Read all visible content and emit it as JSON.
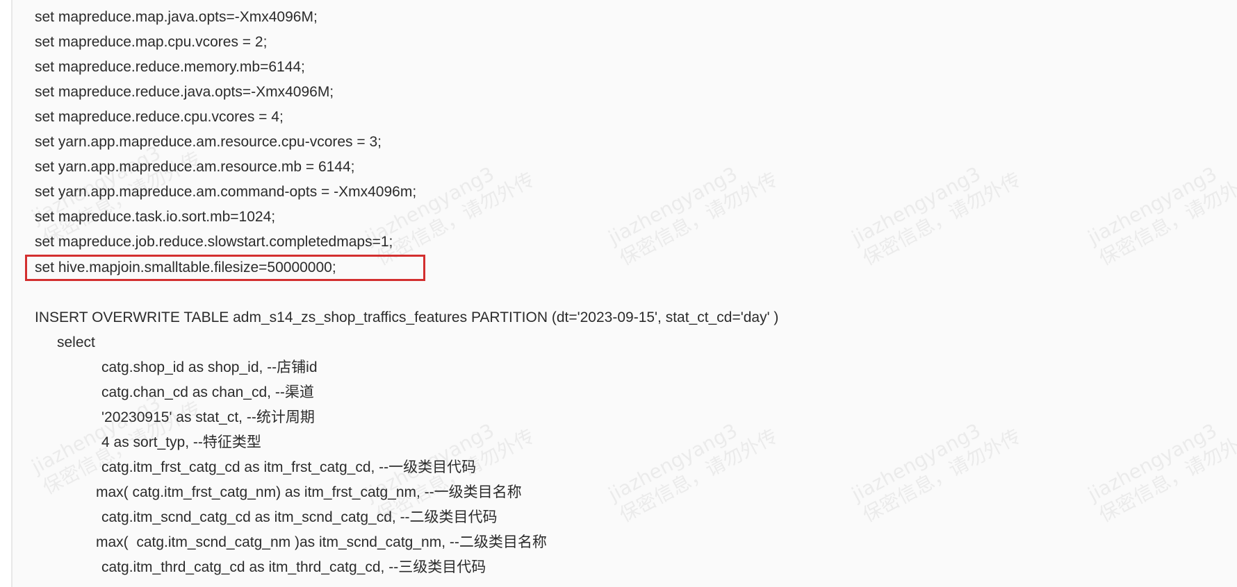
{
  "colors": {
    "background": "#fafafa",
    "text": "#2b2b2b",
    "highlight_border": "#d32f2f",
    "watermark": "#969696"
  },
  "watermark": {
    "username": "jiazhengyang3",
    "notice": "保密信息，请勿外传"
  },
  "code_lines": [
    "set mapreduce.map.java.opts=-Xmx4096M;",
    "set mapreduce.map.cpu.vcores = 2;",
    "set mapreduce.reduce.memory.mb=6144;",
    "set mapreduce.reduce.java.opts=-Xmx4096M;",
    "set mapreduce.reduce.cpu.vcores = 4;",
    "set yarn.app.mapreduce.am.resource.cpu-vcores = 3;",
    "set yarn.app.mapreduce.am.resource.mb = 6144;",
    "set yarn.app.mapreduce.am.command-opts = -Xmx4096m;",
    "set mapreduce.task.io.sort.mb=1024;",
    "set mapreduce.job.reduce.slowstart.completedmaps=1;",
    "set hive.mapjoin.smalltable.filesize=50000000;",
    "INSERT OVERWRITE TABLE adm_s14_zs_shop_traffics_features PARTITION (dt='2023-09-15', stat_ct_cd='day' )",
    "select",
    "catg.shop_id as shop_id, --店铺id",
    "catg.chan_cd as chan_cd, --渠道",
    "'20230915' as stat_ct, --统计周期",
    "4 as sort_typ, --特征类型",
    "catg.itm_frst_catg_cd as itm_frst_catg_cd, --一级类目代码",
    "max( catg.itm_frst_catg_nm) as itm_frst_catg_nm, --一级类目名称",
    "catg.itm_scnd_catg_cd as itm_scnd_catg_cd, --二级类目代码",
    "max(  catg.itm_scnd_catg_nm )as itm_scnd_catg_nm, --二级类目名称",
    "catg.itm_thrd_catg_cd as itm_thrd_catg_cd, --三级类目代码"
  ]
}
